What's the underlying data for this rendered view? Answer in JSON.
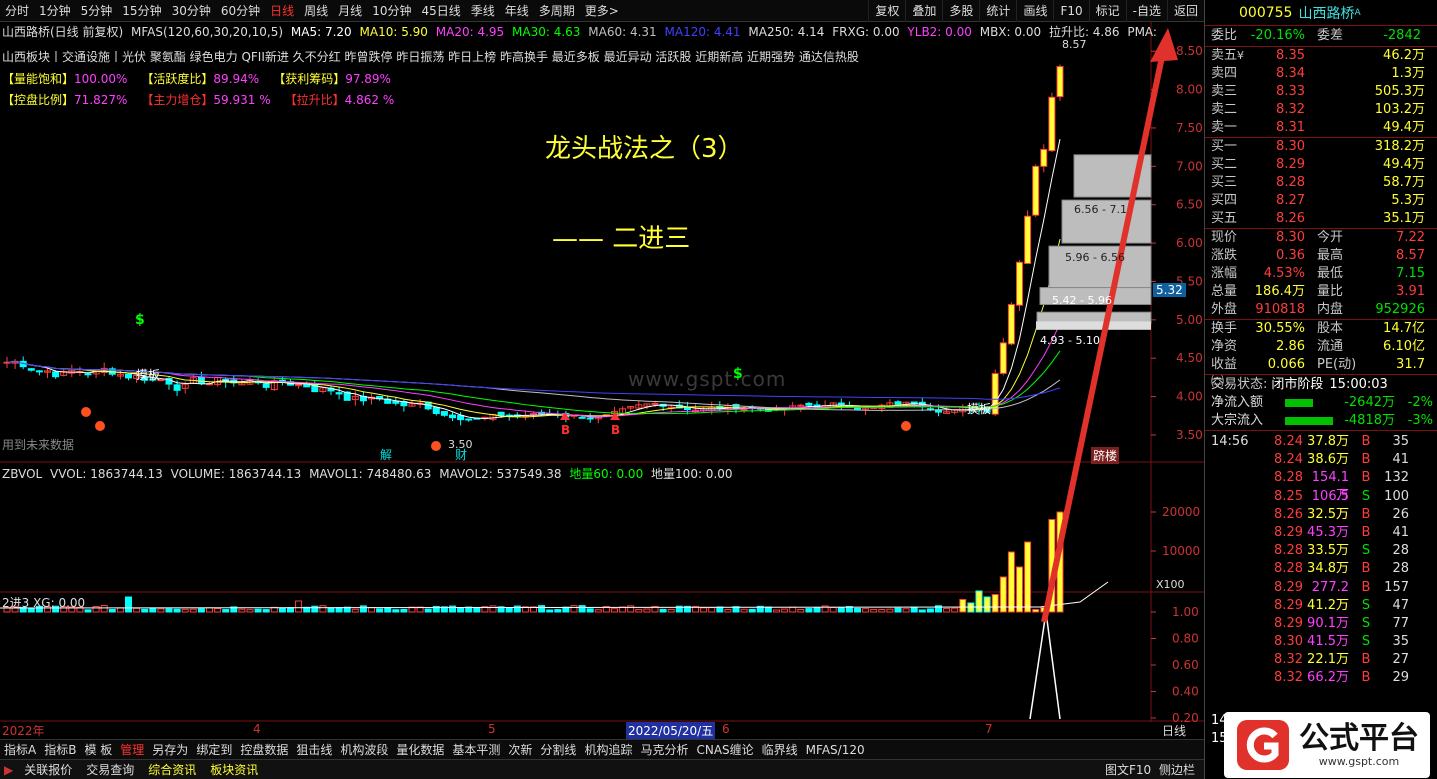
{
  "toolbar": {
    "timeframes": [
      "分时",
      "1分钟",
      "5分钟",
      "15分钟",
      "30分钟",
      "60分钟",
      "日线",
      "周线",
      "月线",
      "10分钟",
      "45日线",
      "季线",
      "年线",
      "多周期",
      "更多>"
    ],
    "active_timeframe": "日线",
    "right_tools": [
      "复权",
      "叠加",
      "多股",
      "统计",
      "画线",
      "F10",
      "标记",
      "-自选",
      "返回"
    ]
  },
  "main_chart": {
    "header": {
      "name": "山西路桥(日线 前复权)",
      "formula": "MFAS(120,60,30,20,10,5)",
      "ma5": "MA5: 7.20",
      "ma10": "MA10: 5.90",
      "ma20": "MA20: 4.95",
      "ma30": "MA30: 4.63",
      "ma60": "MA60: 4.31",
      "ma120": "MA120: 4.41",
      "ma250": "MA250: 4.14",
      "frxg": "FRXG: 0.00",
      "ylb2": "YLB2: 0.00",
      "mbx": "MBX: 0.00",
      "lsb": "拉升比: 4.86",
      "pma": "PMA:"
    },
    "sectors": "山西板块丨交通设施丨光伏 聚氨酯 绿色电力  QFII新进 久不分红 昨曾跌停 昨日振荡 昨日上榜 昨高换手 最近多板 最近异动 活跃股 近期新高 近期强势 通达信热股",
    "ind_row1": [
      {
        "k": "【量能饱和】",
        "v": "100.00%",
        "kc": "#ffff33",
        "vc": "#ff40ff"
      },
      {
        "k": "【活跃度比】",
        "v": "89.94%",
        "kc": "#ffff33",
        "vc": "#ff40ff"
      },
      {
        "k": "【获利筹码】",
        "v": "97.89%",
        "kc": "#ffff33",
        "vc": "#ff40ff"
      }
    ],
    "ind_row2": [
      {
        "k": "【控盘比例】",
        "v": "71.827%",
        "kc": "#ffff33",
        "vc": "#ff40ff"
      },
      {
        "k": "【主力增仓】",
        "v": "59.931 %",
        "kc": "#ff3030",
        "vc": "#ff40ff"
      },
      {
        "k": "【拉升比】",
        "v": "4.862 %",
        "kc": "#ff3030",
        "vc": "#ff40ff"
      }
    ],
    "title": "龙头战法之（3）",
    "subtitle": "——  二进三",
    "watermark": "www.gspt.com",
    "future_note": "用到未来数据",
    "price_axis": [
      "8.50",
      "8.00",
      "7.50",
      "7.00",
      "6.50",
      "6.00",
      "5.50",
      "5.00",
      "4.50",
      "4.00",
      "3.50"
    ],
    "current_price_tag": "5.32",
    "high_label": "8.57",
    "low_label": "3.50",
    "chip_labels": [
      "6.56 - 7.1",
      "5.96 - 6.56",
      "5.42 - 5.96",
      "4.93 - 5.10"
    ],
    "marks": {
      "jie": "解",
      "cai": "财",
      "moban1": "摸板",
      "moban2": "摸板",
      "ganglou": "跻楼",
      "buy": "B",
      "dollar": "$"
    },
    "chips_note": "chip-distribution bars"
  },
  "volume_panel": {
    "header": {
      "name": "ZBVOL",
      "vvol": "VVOL: 1863744.13",
      "volume": "VOLUME: 1863744.13",
      "mavol1": "MAVOL1: 748480.63",
      "mavol2": "MAVOL2: 537549.38",
      "dl60": "地量60: 0.00",
      "dl100": "地量100: 0.00"
    },
    "axis": [
      "20000",
      "10000"
    ],
    "unit": "X100"
  },
  "signal_panel": {
    "header": "2进3 XG: 0.00",
    "axis": [
      "1.00",
      "0.80",
      "0.60",
      "0.40",
      "0.20",
      "0.00"
    ]
  },
  "date_axis": {
    "labels": [
      "2022年",
      "4",
      "5",
      "2022/05/20/五",
      "6",
      "7"
    ],
    "period": "日线"
  },
  "bottom_tabs": [
    "指标A",
    "指标B",
    "模 板",
    "管理",
    "另存为",
    "绑定到",
    "控盘数据",
    "狙击线",
    "机构波段",
    "量化数据",
    "基本平测",
    "次新",
    "分割线",
    "机构追踪",
    "马克分析",
    "CNAS缠论",
    "临界线",
    "MFAS/120"
  ],
  "active_bottom_tab": "管理",
  "status_tabs": [
    "关联报价",
    "交易查询",
    "综合资讯",
    "板块资讯"
  ],
  "status_right": [
    "图文F10",
    "侧边栏"
  ],
  "quote": {
    "code": "000755",
    "name": "山西路桥",
    "sup": "A",
    "weibi_label": "委比",
    "weibi": "-20.16%",
    "weicha_label": "委差",
    "weicha": "-2842",
    "asks": [
      {
        "l": "卖五",
        "p": "8.35",
        "v": "46.2万"
      },
      {
        "l": "卖四",
        "p": "8.34",
        "v": "1.3万"
      },
      {
        "l": "卖三",
        "p": "8.33",
        "v": "505.3万"
      },
      {
        "l": "卖二",
        "p": "8.32",
        "v": "103.2万"
      },
      {
        "l": "卖一",
        "p": "8.31",
        "v": "49.4万"
      }
    ],
    "bids": [
      {
        "l": "买一",
        "p": "8.30",
        "v": "318.2万"
      },
      {
        "l": "买二",
        "p": "8.29",
        "v": "49.4万"
      },
      {
        "l": "买三",
        "p": "8.28",
        "v": "58.7万"
      },
      {
        "l": "买四",
        "p": "8.27",
        "v": "5.3万"
      },
      {
        "l": "买五",
        "p": "8.26",
        "v": "35.1万"
      }
    ],
    "yen": "¥",
    "stats": [
      [
        {
          "l": "现价",
          "v": "8.30",
          "c": "red"
        },
        {
          "l": "今开",
          "v": "7.22",
          "c": "red"
        }
      ],
      [
        {
          "l": "涨跌",
          "v": "0.36",
          "c": "red"
        },
        {
          "l": "最高",
          "v": "8.57",
          "c": "red"
        }
      ],
      [
        {
          "l": "涨幅",
          "v": "4.53%",
          "c": "red"
        },
        {
          "l": "最低",
          "v": "7.15",
          "c": "grn"
        }
      ],
      [
        {
          "l": "总量",
          "v": "186.4万",
          "c": "yel"
        },
        {
          "l": "量比",
          "v": "3.91",
          "c": "red"
        }
      ],
      [
        {
          "l": "外盘",
          "v": "910818",
          "c": "red"
        },
        {
          "l": "内盘",
          "v": "952926",
          "c": "grn"
        }
      ]
    ],
    "stats2": [
      [
        {
          "l": "换手",
          "v": "30.55%",
          "c": "yel"
        },
        {
          "l": "股本",
          "v": "14.7亿",
          "c": "yel"
        }
      ],
      [
        {
          "l": "净资",
          "v": "2.86",
          "c": "yel"
        },
        {
          "l": "流通",
          "v": "6.10亿",
          "c": "yel"
        }
      ],
      [
        {
          "l": "收益㈡",
          "v": "0.066",
          "c": "yel"
        },
        {
          "l": "PE(动)",
          "v": "31.7",
          "c": "yel"
        }
      ]
    ],
    "trade_state_label": "交易状态:",
    "trade_state": "闭市阶段",
    "trade_time": "15:00:03",
    "flows": [
      {
        "l": "净流入额",
        "v": "-2642万",
        "p": "-2%",
        "ratio": 0.55
      },
      {
        "l": "大宗流入",
        "v": "-4818万",
        "p": "-3%",
        "ratio": 0.95
      }
    ],
    "ticks": [
      {
        "t": "14:56",
        "p": "8.24",
        "v": "37.8万",
        "s": "B",
        "n": "35",
        "pc": "red",
        "vc": "yel"
      },
      {
        "t": "",
        "p": "8.24",
        "v": "38.6万",
        "s": "B",
        "n": "41",
        "pc": "red",
        "vc": "yel"
      },
      {
        "t": "",
        "p": "8.28",
        "v": "154.1万",
        "s": "B",
        "n": "132",
        "pc": "red",
        "vc": "mag"
      },
      {
        "t": "",
        "p": "8.25",
        "v": "106.5万",
        "s": "S",
        "n": "100",
        "pc": "red",
        "vc": "mag"
      },
      {
        "t": "",
        "p": "8.26",
        "v": "32.5万",
        "s": "B",
        "n": "26",
        "pc": "red",
        "vc": "yel"
      },
      {
        "t": "",
        "p": "8.29",
        "v": "45.3万",
        "s": "B",
        "n": "41",
        "pc": "red",
        "vc": "mag"
      },
      {
        "t": "",
        "p": "8.28",
        "v": "33.5万",
        "s": "S",
        "n": "28",
        "pc": "red",
        "vc": "yel"
      },
      {
        "t": "",
        "p": "8.28",
        "v": "34.8万",
        "s": "B",
        "n": "28",
        "pc": "red",
        "vc": "yel"
      },
      {
        "t": "",
        "p": "8.29",
        "v": "277.2万",
        "s": "B",
        "n": "157",
        "pc": "red",
        "vc": "mag"
      },
      {
        "t": "",
        "p": "8.29",
        "v": "41.2万",
        "s": "S",
        "n": "47",
        "pc": "red",
        "vc": "yel"
      },
      {
        "t": "",
        "p": "8.29",
        "v": "90.1万",
        "s": "S",
        "n": "77",
        "pc": "red",
        "vc": "mag"
      },
      {
        "t": "",
        "p": "8.30",
        "v": "41.5万",
        "s": "S",
        "n": "35",
        "pc": "red",
        "vc": "mag"
      },
      {
        "t": "",
        "p": "8.32",
        "v": "22.1万",
        "s": "B",
        "n": "27",
        "pc": "red",
        "vc": "yel"
      },
      {
        "t": "",
        "p": "8.32",
        "v": "66.2万",
        "s": "B",
        "n": "29",
        "pc": "red",
        "vc": "mag"
      }
    ],
    "side_nums": [
      "14",
      "15"
    ],
    "logo_text": "公式平台",
    "logo_url": "www.gspt.com"
  },
  "colors": {
    "up": "#ff3c3c",
    "down": "#00ffff",
    "ma5": "#ffffff",
    "ma10": "#ffff33",
    "ma20": "#ff40ff",
    "ma30": "#00ff00",
    "ma60": "#c0c0c0",
    "ma120": "#4040ff",
    "arrow": "#e0322a",
    "title": "#ffff33"
  }
}
